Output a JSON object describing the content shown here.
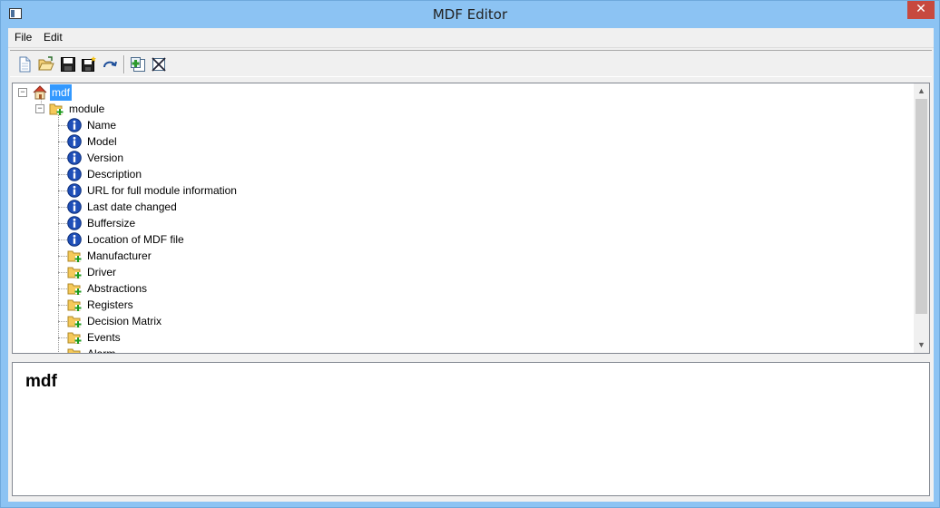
{
  "window": {
    "title": "MDF Editor",
    "close_glyph": "✕"
  },
  "menu": {
    "file": "File",
    "edit": "Edit"
  },
  "toolbar": {
    "buttons": [
      "new-file-icon",
      "open-folder-icon",
      "save-icon",
      "save-as-icon",
      "redo-icon",
      "add-item-icon",
      "delete-item-icon"
    ]
  },
  "tree": {
    "root": {
      "label": "mdf",
      "expander": "⊟"
    },
    "module": {
      "label": "module",
      "expander": "⊟"
    },
    "children": [
      {
        "label": "Name",
        "icon": "info-icon"
      },
      {
        "label": "Model",
        "icon": "info-icon"
      },
      {
        "label": "Version",
        "icon": "info-icon"
      },
      {
        "label": "Description",
        "icon": "info-icon"
      },
      {
        "label": "URL for full module information",
        "icon": "info-icon"
      },
      {
        "label": "Last date changed",
        "icon": "info-icon"
      },
      {
        "label": "Buffersize",
        "icon": "info-icon"
      },
      {
        "label": "Location of MDF file",
        "icon": "info-icon"
      },
      {
        "label": "Manufacturer",
        "icon": "folder-add-icon"
      },
      {
        "label": "Driver",
        "icon": "folder-add-icon"
      },
      {
        "label": "Abstractions",
        "icon": "folder-add-icon"
      },
      {
        "label": "Registers",
        "icon": "folder-add-icon"
      },
      {
        "label": "Decision Matrix",
        "icon": "folder-add-icon"
      },
      {
        "label": "Events",
        "icon": "folder-add-icon"
      },
      {
        "label": "Alarm",
        "icon": "folder-add-icon"
      }
    ]
  },
  "scrollbar": {
    "up": "▲",
    "down": "▼"
  },
  "description": {
    "heading": "mdf"
  }
}
